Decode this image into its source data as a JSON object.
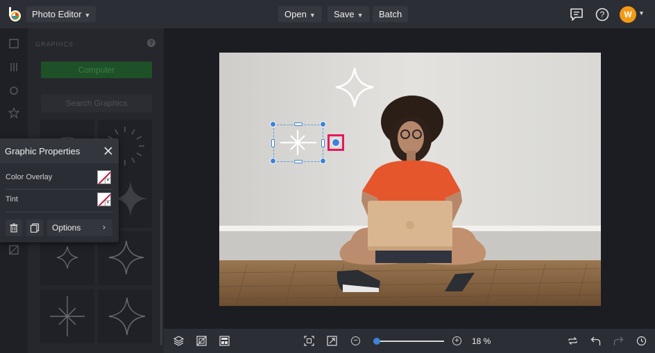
{
  "app": {
    "name": "Photo Editor",
    "logo_icon": "befunky-logo-icon",
    "accent": "#3f82d6"
  },
  "topbar": {
    "menus": [
      {
        "label": "Open"
      },
      {
        "label": "Save"
      },
      {
        "label": "Batch"
      }
    ],
    "icons": [
      "comments-icon",
      "help-icon"
    ],
    "avatar_initial": "W",
    "avatar_color": "#f29a16"
  },
  "graphics_panel": {
    "title": "GRAPHICS",
    "computer_button": "Computer",
    "search_placeholder": "Search Graphics"
  },
  "graphic_properties": {
    "title": "Graphic Properties",
    "rows": [
      {
        "label": "Color Overlay"
      },
      {
        "label": "Tint"
      }
    ],
    "options_label": "Options",
    "options_arrow": "›"
  },
  "zoom": {
    "value_label": "18 %",
    "level_fraction": 0.0
  },
  "colors": {
    "selection_handle": "#3f82d6",
    "highlight": "#e3195b",
    "computer_button_bg": "#1f5128"
  }
}
